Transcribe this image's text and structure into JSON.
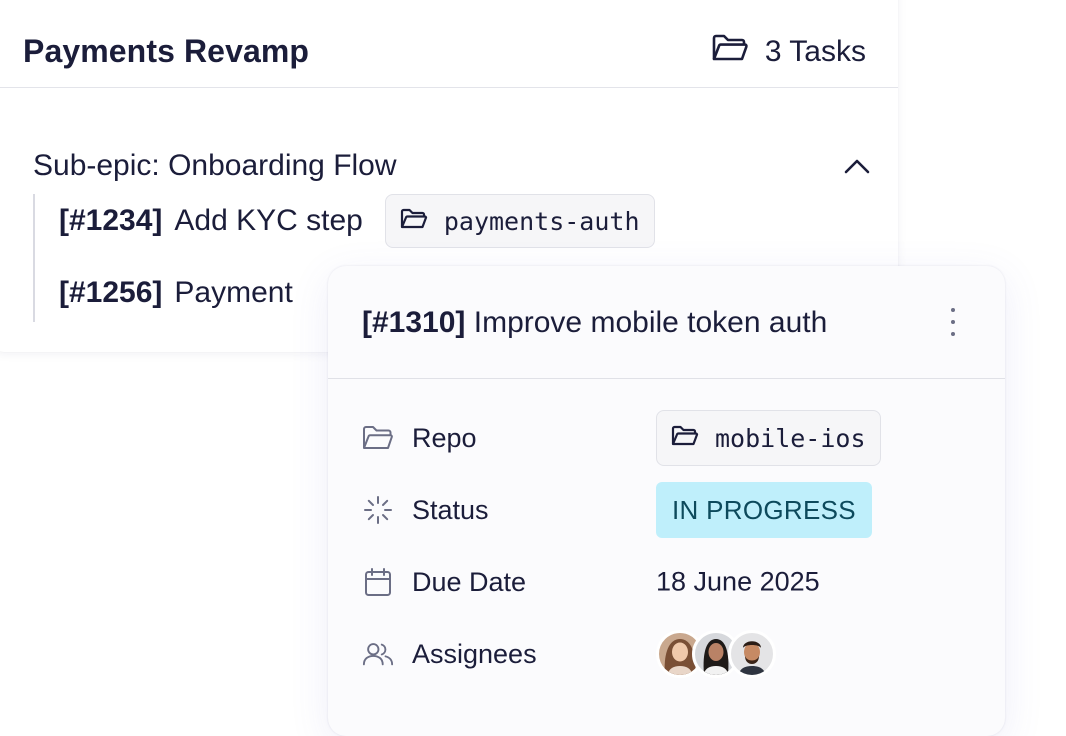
{
  "epic": {
    "title": "Payments Revamp",
    "task_count": "3 Tasks",
    "sub_epic": {
      "label": "Sub-epic: Onboarding Flow",
      "tasks": [
        {
          "id": "[#1234]",
          "title": "Add KYC step",
          "repo": "payments-auth"
        },
        {
          "id": "[#1256]",
          "title": "Payment"
        }
      ]
    }
  },
  "detail": {
    "id": "[#1310]",
    "title": "Improve mobile token auth",
    "properties": {
      "repo": {
        "label": "Repo",
        "value": "mobile-ios",
        "icon": "folder-icon"
      },
      "status": {
        "label": "Status",
        "value": "IN PROGRESS",
        "icon": "spinner-icon"
      },
      "due_date": {
        "label": "Due Date",
        "value": "18 June 2025",
        "icon": "calendar-icon"
      },
      "assignees": {
        "label": "Assignees",
        "count": 3,
        "icon": "users-icon"
      }
    }
  },
  "colors": {
    "text": "#1b1d3a",
    "status_bg": "#bfeffb",
    "status_text": "#0d4a5c",
    "icon": "#6b6e85"
  }
}
